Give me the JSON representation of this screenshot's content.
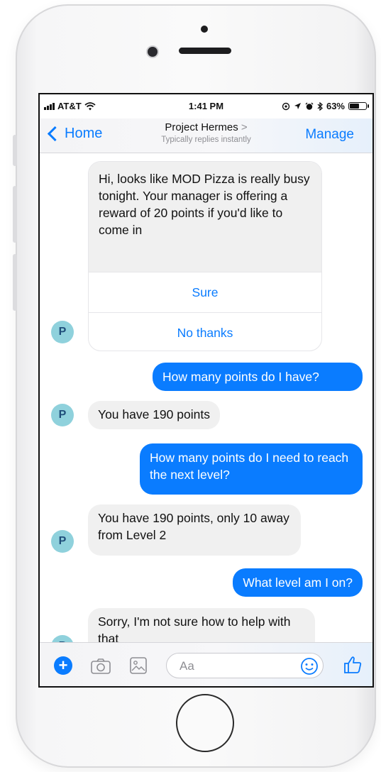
{
  "status": {
    "carrier": "AT&T",
    "time": "1:41 PM",
    "battery": "63%",
    "battery_level": 0.63
  },
  "nav": {
    "back_label": "Home",
    "title": "Project Hermes",
    "subtitle": "Typically replies instantly",
    "manage_label": "Manage"
  },
  "avatar_letter": "P",
  "card": {
    "text": "Hi, looks like MOD Pizza is really busy tonight. Your manager is offering a reward of 20 points if you'd like to come in",
    "buttons": [
      "Sure",
      "No thanks"
    ]
  },
  "messages": [
    {
      "from": "me",
      "text": "How many points do I have?"
    },
    {
      "from": "bot",
      "text": "You have 190 points"
    },
    {
      "from": "me",
      "text": "How many points do I need to reach the next level?"
    },
    {
      "from": "bot",
      "text": "You have 190 points, only 10 away from Level 2"
    },
    {
      "from": "me",
      "text": "What level am I on?"
    },
    {
      "from": "bot",
      "text": "Sorry, I'm not sure how to help with that"
    }
  ],
  "composer": {
    "placeholder": "Aa"
  },
  "icons": [
    "wifi-icon",
    "location-icon",
    "alarm-icon",
    "bluetooth-icon",
    "plus-icon",
    "camera-icon",
    "image-icon",
    "emoji-icon",
    "like-icon"
  ],
  "colors": {
    "accent": "#0a7cff",
    "bubble_in": "#f0f0f0",
    "avatar": "#8fd1dc"
  }
}
